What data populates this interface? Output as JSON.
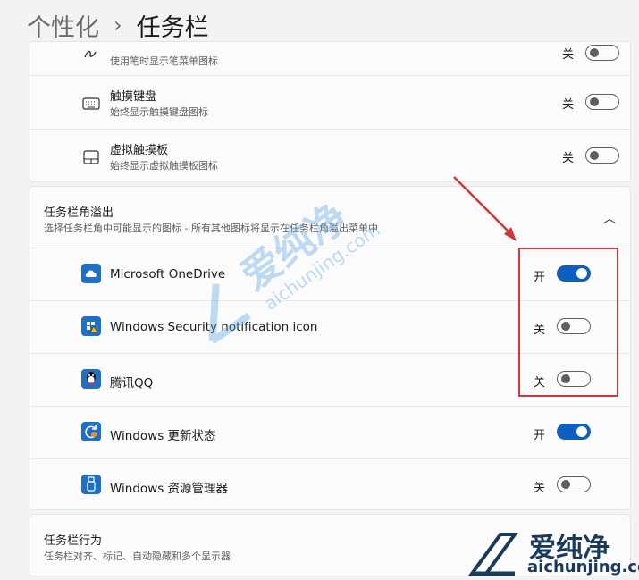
{
  "breadcrumb": {
    "parent": "个性化",
    "separator": "›",
    "current": "任务栏"
  },
  "pen_row": {
    "subtitle": "使用笔时显示笔菜单图标",
    "state": "关"
  },
  "touch_keyboard": {
    "title": "触摸键盘",
    "subtitle": "始终显示触摸键盘图标",
    "state": "关"
  },
  "virtual_touchpad": {
    "title": "虚拟触摸板",
    "subtitle": "始终显示虚拟触摸板图标",
    "state": "关"
  },
  "overflow_section": {
    "title": "任务栏角溢出",
    "description": "选择任务栏角中可能显示的图标 - 所有其他图标将显示在任务栏角溢出菜单中",
    "items": [
      {
        "label": "Microsoft OneDrive",
        "state": "开",
        "on": true,
        "icon": "onedrive-icon"
      },
      {
        "label": "Windows Security notification icon",
        "state": "关",
        "on": false,
        "icon": "windows-security-icon"
      },
      {
        "label": "腾讯QQ",
        "state": "关",
        "on": false,
        "icon": "qq-icon"
      },
      {
        "label": "Windows 更新状态",
        "state": "开",
        "on": true,
        "icon": "windows-update-icon"
      },
      {
        "label": "Windows 资源管理器",
        "state": "关",
        "on": false,
        "icon": "usb-explorer-icon"
      }
    ]
  },
  "behavior_section": {
    "title": "任务栏行为",
    "description": "任务栏对齐、标记、自动隐藏和多个显示器"
  },
  "watermark": {
    "brand": "爱纯净",
    "domain": "aichunjing.com"
  },
  "colors": {
    "accent": "#0f5fc0",
    "highlight": "#d8323a",
    "background": "#f3f3f3",
    "card": "#fbfbfb"
  }
}
